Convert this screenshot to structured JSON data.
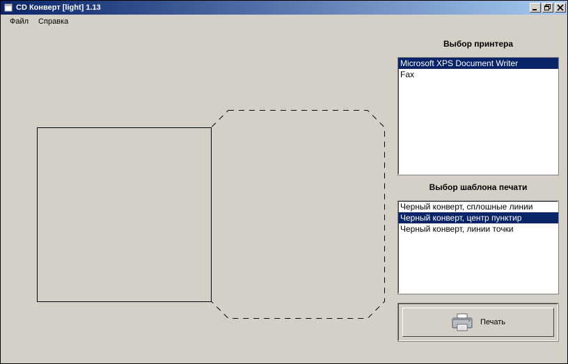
{
  "title": "CD Конверт [light] 1.13",
  "menu": {
    "file": "Файл",
    "help": "Справка"
  },
  "printer_section": {
    "label": "Выбор принтера",
    "items": [
      "Microsoft XPS Document Writer",
      "Fax"
    ],
    "selected_index": 0
  },
  "template_section": {
    "label": "Выбор шаблона печати",
    "items": [
      "Черный конверт, сплошные линии",
      "Черный конверт, центр пунктир",
      "Черный конверт, линии точки"
    ],
    "selected_index": 1
  },
  "print_button": {
    "label": "Печать"
  },
  "window_buttons": {
    "minimize": "minimize",
    "restore": "restore",
    "close": "close"
  }
}
